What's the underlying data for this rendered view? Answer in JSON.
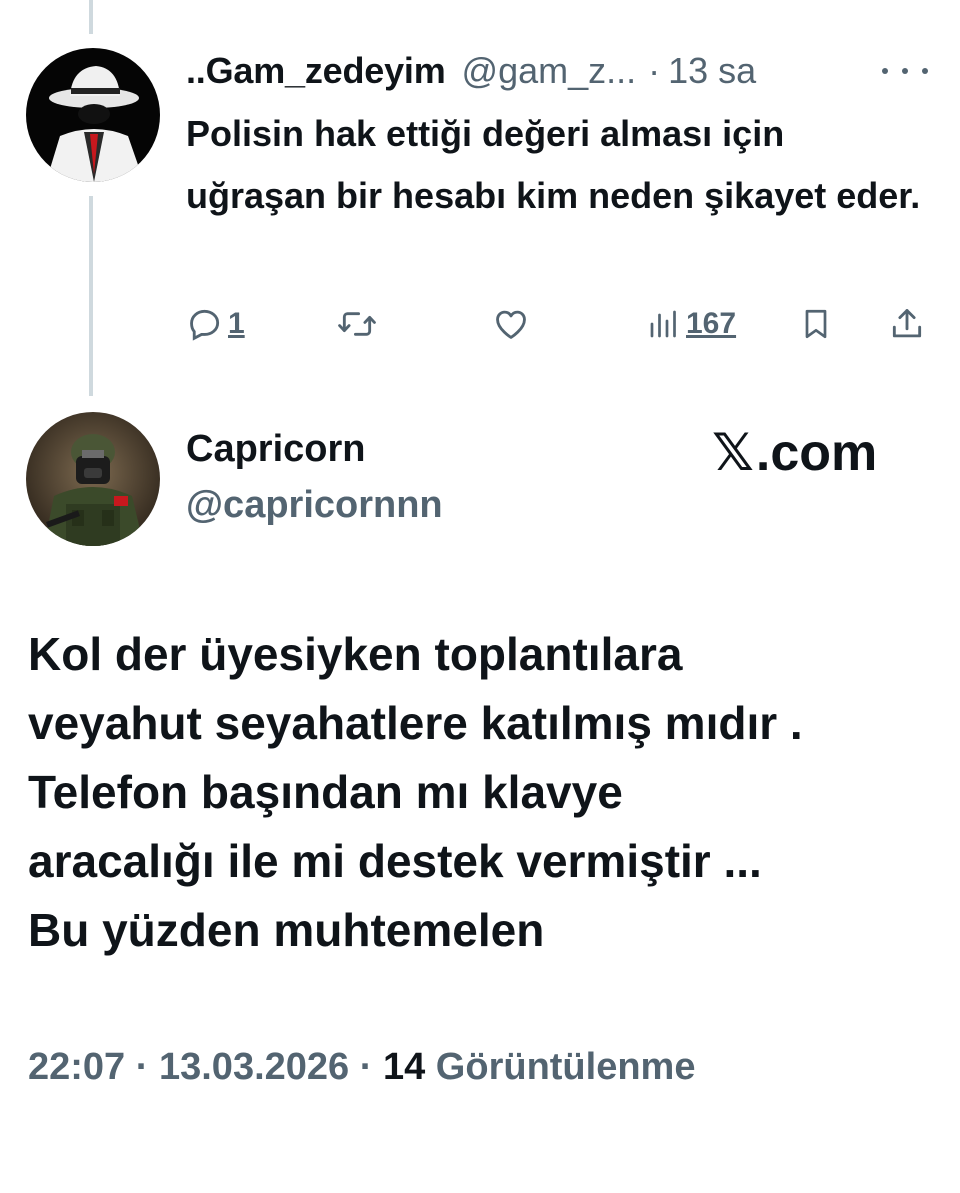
{
  "reply_tweet": {
    "display_name": "..Gam_zedeyim",
    "handle": "@gam_z...",
    "separator": "·",
    "time": "13 sa",
    "text": "Polisin hak ettiği değeri alması için uğraşan bir hesabı kim neden şikayet eder.",
    "reply_count": "1",
    "view_count": "167"
  },
  "main_tweet": {
    "display_name": "Capricorn",
    "handle": "@capricornnn",
    "watermark": ".com",
    "text_lines": [
      "Kol der üyesiyken toplantılara",
      "veyahut seyahatlere katılmış mıdır .",
      "Telefon başından mı klavye",
      "aracalığı ile mi destek vermiştir ...",
      "Bu yüzden muhtemelen"
    ],
    "time": "22:07",
    "date": "13.03.2026",
    "separator": "·",
    "views_number": "14",
    "views_label": "Görüntülenme"
  },
  "icons": {
    "reply": "reply-icon",
    "retweet": "retweet-icon",
    "like": "heart-icon",
    "views": "views-chart-icon",
    "bookmark": "bookmark-icon",
    "share": "share-icon",
    "more": "more-dots-icon",
    "x_logo": "x-logo-icon"
  },
  "colors": {
    "text": "#0f1419",
    "secondary": "#536471",
    "thread_line": "#cfd9de"
  }
}
